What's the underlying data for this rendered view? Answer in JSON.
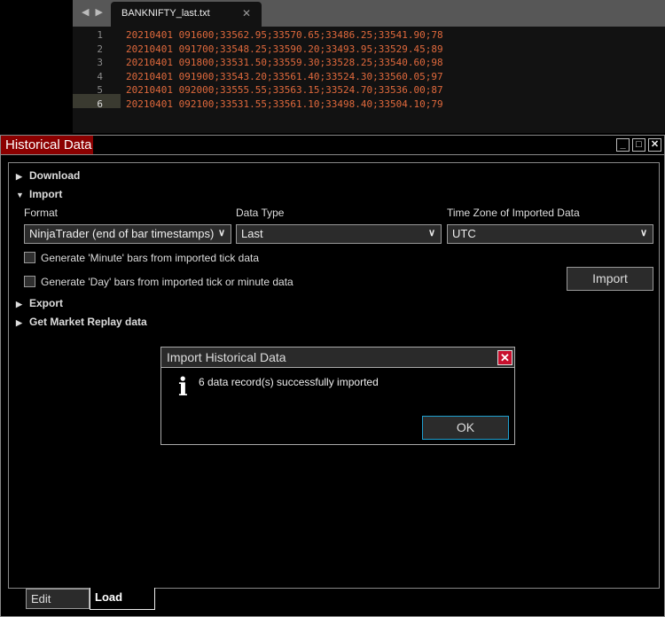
{
  "editor": {
    "tab_title": "BANKNIFTY_last.txt",
    "current_line": 6,
    "lines": [
      "20210401 091600;33562.95;33570.65;33486.25;33541.90;78",
      "20210401 091700;33548.25;33590.20;33493.95;33529.45;89",
      "20210401 091800;33531.50;33559.30;33528.25;33540.60;98",
      "20210401 091900;33543.20;33561.40;33524.30;33560.05;97",
      "20210401 092000;33555.55;33563.15;33524.70;33536.00;87",
      "20210401 092100;33531.55;33561.10;33498.40;33504.10;79"
    ]
  },
  "window": {
    "title": "Historical Data",
    "sections": {
      "download": "Download",
      "import": "Import",
      "export": "Export",
      "replay": "Get Market Replay data"
    },
    "import": {
      "format_label": "Format",
      "format_value": "NinjaTrader (end of bar timestamps)",
      "datatype_label": "Data Type",
      "datatype_value": "Last",
      "tz_label": "Time Zone of Imported Data",
      "tz_value": "UTC",
      "cb_minute": "Generate 'Minute' bars from imported tick data",
      "cb_day": "Generate 'Day' bars from imported tick or minute data",
      "import_button": "Import"
    },
    "tabs": {
      "edit": "Edit",
      "load": "Load"
    }
  },
  "dialog": {
    "title": "Import Historical Data",
    "message": "6 data record(s) successfully imported",
    "ok": "OK"
  }
}
